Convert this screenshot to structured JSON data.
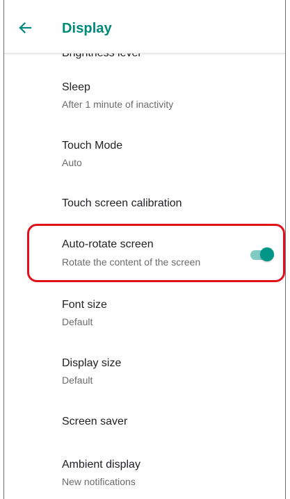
{
  "header": {
    "title": "Display",
    "back_icon": "arrow-back-icon",
    "accent_color": "#00897b"
  },
  "partially_hidden_item_fragment": "Brightness level",
  "settings": {
    "sleep": {
      "title": "Sleep",
      "summary": "After 1 minute of inactivity"
    },
    "touch_mode": {
      "title": "Touch Mode",
      "summary": "Auto"
    },
    "touch_calibration": {
      "title": "Touch screen calibration"
    },
    "auto_rotate": {
      "title": "Auto-rotate screen",
      "summary": "Rotate the content of the screen",
      "toggle_state": "on",
      "toggle_color": "#009688",
      "highlight_color": "#e1101b"
    },
    "font_size": {
      "title": "Font size",
      "summary": "Default"
    },
    "display_size": {
      "title": "Display size",
      "summary": "Default"
    },
    "screen_saver": {
      "title": "Screen saver"
    },
    "ambient_display": {
      "title": "Ambient display",
      "summary": "New notifications"
    }
  }
}
